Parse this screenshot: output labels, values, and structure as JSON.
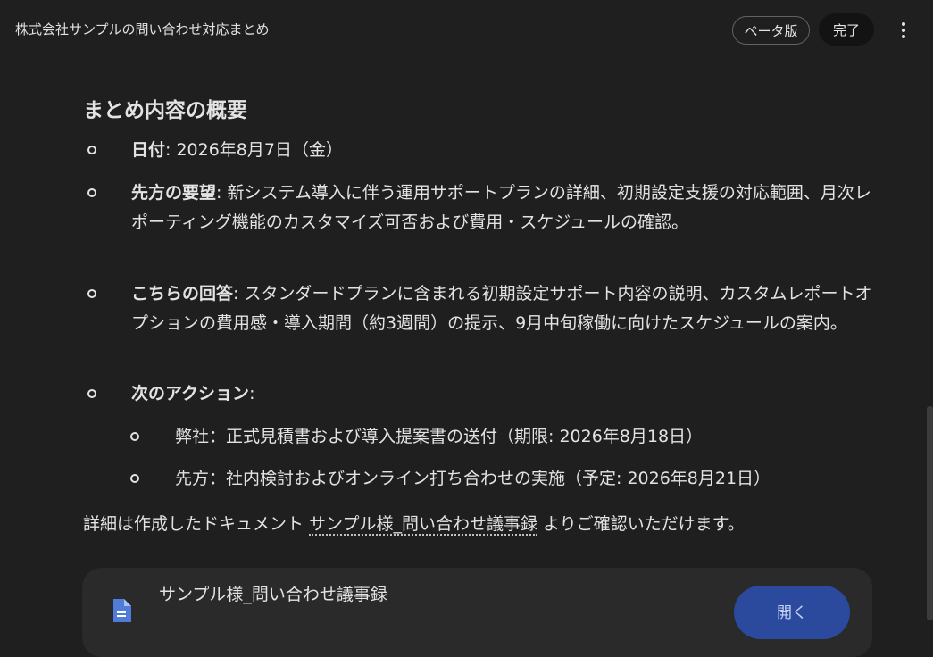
{
  "header": {
    "title": "株式会社サンプルの問い合わせ対応まとめ",
    "beta_label": "ベータ版",
    "done_label": "完了"
  },
  "summary": {
    "heading": "まとめ内容の概要",
    "items": [
      {
        "label": "日付",
        "text": ": 2026年8月7日（金）"
      },
      {
        "label": "先方の要望",
        "text": ": 新システム導入に伴う運用サポートプランの詳細、初期設定支援の対応範囲、月次レポーティング機能のカスタマイズ可否および費用・スケジュールの確認。"
      },
      {
        "label": "こちらの回答",
        "text": ": スタンダードプランに含まれる初期設定サポート内容の説明、カスタムレポートオプションの費用感・導入期間（約3週間）の提示、9月中旬稼働に向けたスケジュールの案内。"
      },
      {
        "label": "次のアクション",
        "text": ":"
      }
    ],
    "actions": [
      "弊社：正式見積書および導入提案書の送付（期限: 2026年8月18日）",
      "先方：社内検討およびオンライン打ち合わせの実施（予定: 2026年8月21日）"
    ],
    "footer_prefix": "詳細は作成したドキュメント ",
    "footer_link": "サンプル様_問い合わせ議事録",
    "footer_suffix": " よりご確認いただけます。"
  },
  "card": {
    "title": "サンプル様_問い合わせ議事録",
    "open_label": "開く",
    "icon": "google-docs-icon"
  },
  "colors": {
    "background": "#1f1f1f",
    "text": "#e3e3e3",
    "open_button": "#2b4a9e"
  }
}
